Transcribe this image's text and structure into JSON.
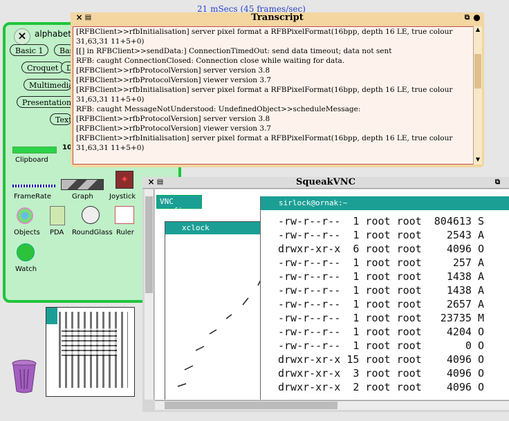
{
  "fps": "21 mSecs (45 frames/sec)",
  "flap": {
    "title": "alphabeti",
    "buttons": [
      "Basic 1",
      "Bas",
      "Croquet",
      "De",
      "Multimedia",
      "Presentation",
      "Text"
    ],
    "tools": [
      "Clipboard",
      "FrameRate",
      "Graph",
      "Joystick",
      "Objects",
      "PDA",
      "RoundGlass",
      "Ruler",
      "Watch"
    ],
    "clipboard_number": "10:"
  },
  "transcript": {
    "title": "Transcript",
    "lines": [
      "[RFBClient>>rfbInitialisation] server pixel format a RFBPixelFormat(16bpp, depth 16 LE, true colour",
      "31,63,31 11+5+0)",
      "[[] in RFBClient>>sendData:] ConnectionTimedOut: send data timeout; data not sent",
      "RFB: caught ConnectionClosed: Connection close while waiting for data.",
      "[RFBClient>>rfbProtocolVersion] server version 3.8",
      "[RFBClient>>rfbProtocolVersion] viewer version 3.7",
      "[RFBClient>>rfbInitialisation] server pixel format a RFBPixelFormat(16bpp, depth 16 LE, true colour",
      "31,63,31 11+5+0)",
      "RFB: caught MessageNotUnderstood: UndefinedObject>>scheduleMessage:",
      "[RFBClient>>rfbProtocolVersion] server version 3.8",
      "[RFBClient>>rfbProtocolVersion] viewer version 3.7",
      "[RFBClient>>rfbInitialisation] server pixel format a RFBPixelFormat(16bpp, depth 16 LE, true colour",
      "31,63,31 11+5+0)"
    ]
  },
  "vnc": {
    "title": "SqueakVNC",
    "tab1": "VNC config",
    "tab2": "xclock",
    "tab3": "sirlock@ornak:~",
    "ls_rows": [
      "-rw-r--r--  1 root root  804613 S",
      "-rw-r--r--  1 root root    2543 A",
      "drwxr-xr-x  6 root root    4096 O",
      "-rw-r--r--  1 root root     257 A",
      "-rw-r--r--  1 root root    1438 A",
      "-rw-r--r--  1 root root    1438 A",
      "-rw-r--r--  1 root root    2657 A",
      "-rw-r--r--  1 root root   23735 M",
      "-rw-r--r--  1 root root    4204 O",
      "-rw-r--r--  1 root root       0 O",
      "drwxr-xr-x 15 root root    4096 O",
      "drwxr-xr-x  3 root root    4096 O",
      "drwxr-xr-x  2 root root    4096 O"
    ]
  },
  "colors": {
    "flap_border": "#21c43b",
    "flap_bg": "#bff0c8",
    "transcript_frame": "#f3d6a0",
    "teal": "#1b9f95"
  }
}
